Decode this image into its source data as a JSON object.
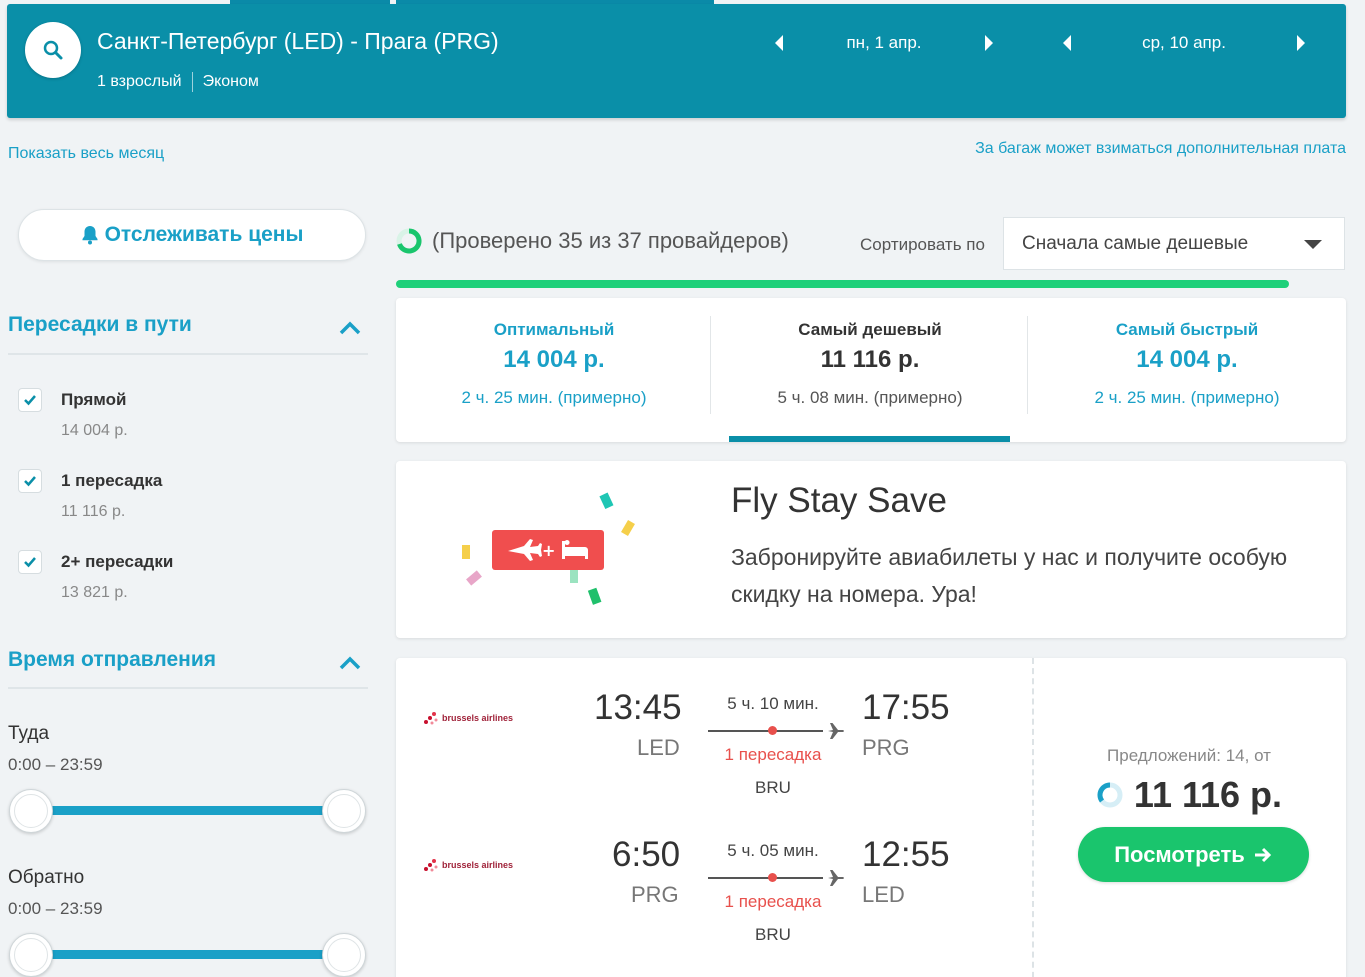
{
  "header": {
    "route": "Санкт-Петербург (LED) - Прага (PRG)",
    "passengers": "1 взрослый",
    "cabin": "Эконом",
    "depart_date": "пн, 1 апр.",
    "return_date": "ср, 10 апр."
  },
  "links": {
    "show_month": "Показать весь месяц",
    "baggage_note": "За багаж может взиматься дополнительная плата"
  },
  "sidebar": {
    "track_prices": "Отслеживать цены",
    "stops_title": "Пересадки в пути",
    "stops": [
      {
        "label": "Прямой",
        "price": "14 004 р."
      },
      {
        "label": "1 пересадка",
        "price": "11 116 р."
      },
      {
        "label": "2+ пересадки",
        "price": "13 821 р."
      }
    ],
    "departure_title": "Время отправления",
    "outbound_label": "Туда",
    "outbound_range": "0:00 – 23:59",
    "return_label": "Обратно",
    "return_range": "0:00 – 23:59"
  },
  "status": {
    "checked": "(Проверено 35 из 37 провайдеров)",
    "sort_label": "Сортировать по",
    "sort_value": "Сначала самые дешевые"
  },
  "tabs": [
    {
      "name": "Оптимальный",
      "price": "14 004 р.",
      "duration": "2 ч. 25 мин. (примерно)"
    },
    {
      "name": "Самый дешевый",
      "price": "11 116 р.",
      "duration": "5 ч. 08 мин. (примерно)"
    },
    {
      "name": "Самый быстрый",
      "price": "14 004 р.",
      "duration": "2 ч. 25 мин. (примерно)"
    }
  ],
  "promo": {
    "title": "Fly Stay Save",
    "text": "Забронируйте авиабилеты у нас и получите особую скидку на номера. Ура!"
  },
  "ticket": {
    "airline": "brussels airlines",
    "legs": [
      {
        "dep_time": "13:45",
        "dep_code": "LED",
        "duration": "5 ч. 10 мин.",
        "stops": "1 пересадка",
        "via": "BRU",
        "arr_time": "17:55",
        "arr_code": "PRG"
      },
      {
        "dep_time": "6:50",
        "dep_code": "PRG",
        "duration": "5 ч. 05 мин.",
        "stops": "1 пересадка",
        "via": "BRU",
        "arr_time": "12:55",
        "arr_code": "LED"
      }
    ],
    "offers": "Предложений: 14, от",
    "price": "11 116 р.",
    "view_button": "Посмотреть"
  }
}
